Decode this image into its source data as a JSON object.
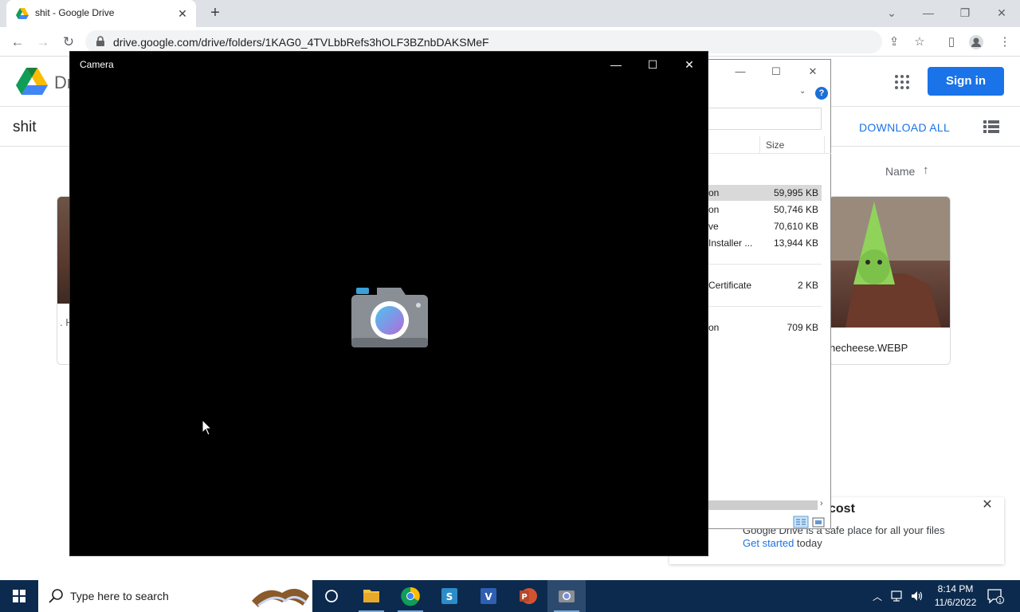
{
  "browser": {
    "tab_title": "shit - Google Drive",
    "url": "drive.google.com/drive/folders/1KAG0_4TVLbbRefs3hOLF3BZnbDAKSMeF"
  },
  "drive": {
    "brand": "Dr",
    "signin_label": "Sign in",
    "folder_name": "shit",
    "download_all": "DOWNLOAD ALL",
    "sort_label": "Name",
    "files": [
      {
        "name": ". H"
      },
      {
        "name": "hecheese.WEBP"
      }
    ],
    "promo": {
      "title": "cost",
      "body": "Google Drive is a safe place for all your files",
      "cta": "Get started",
      "cta_tail": " today"
    }
  },
  "explorer": {
    "size_header": "Size",
    "rows": [
      {
        "type": "on",
        "size": "59,995 KB",
        "selected": true
      },
      {
        "type": "on",
        "size": "50,746 KB"
      },
      {
        "type": "ve",
        "size": "70,610 KB"
      },
      {
        "type": "Installer ...",
        "size": "13,944 KB"
      },
      {
        "type": "Certificate",
        "size": "2 KB"
      },
      {
        "type": "on",
        "size": "709 KB"
      }
    ]
  },
  "camera": {
    "title": "Camera"
  },
  "taskbar": {
    "search_placeholder": "Type here to search",
    "time": "8:14 PM",
    "date": "11/6/2022"
  },
  "colors": {
    "drive_blue": "#1a73e8",
    "taskbar": "#0c2a4d",
    "camera_bg": "#000000"
  }
}
